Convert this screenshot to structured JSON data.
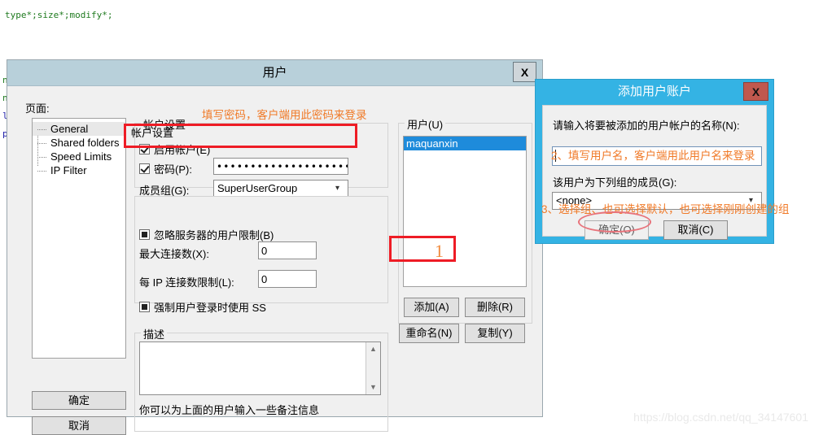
{
  "background": {
    "code_line": "type*;size*;modify*;",
    "left_fragments": [
      "n",
      "n",
      "l",
      "p"
    ]
  },
  "users_window": {
    "title": "用户",
    "close_label": "X",
    "pages_label": "页面:",
    "pages": [
      {
        "label": "General",
        "selected": true
      },
      {
        "label": "Shared folders",
        "selected": false
      },
      {
        "label": "Speed Limits",
        "selected": false
      },
      {
        "label": "IP Filter",
        "selected": false
      }
    ],
    "account_group": {
      "title": "帐户设置",
      "enable_account": {
        "label": "启用帐户(E)",
        "checked": true
      },
      "password": {
        "label": "密码(P):",
        "checked": true,
        "value": "••••••••••••••••••••••••"
      },
      "group_label": "成员组(G):",
      "group_value": "SuperUserGroup"
    },
    "limits_group": {
      "bypass": {
        "label": "忽略服务器的用户限制(B)",
        "state": "indeterminate"
      },
      "max_conn_label": "最大连接数(X):",
      "max_conn_value": "0",
      "per_ip_label": "每 IP 连接数限制(L):",
      "per_ip_value": "0",
      "force_ssl": {
        "label": "强制用户登录时使用 SS",
        "state": "indeterminate"
      }
    },
    "description_group": {
      "title": "描述",
      "value": "",
      "hint": "你可以为上面的用户输入一些备注信息"
    },
    "users_group": {
      "title": "用户(U)",
      "items": [
        {
          "label": "maquanxin",
          "selected": true
        }
      ],
      "buttons": {
        "add": "添加(A)",
        "remove": "删除(R)",
        "rename": "重命名(N)",
        "copy": "复制(Y)"
      }
    },
    "footer_buttons": {
      "ok": "确定",
      "cancel": "取消"
    }
  },
  "add_account_window": {
    "title": "添加用户账户",
    "close_label": "X",
    "name_prompt": "请输入将要被添加的用户帐户的名称(N):",
    "name_value": "",
    "group_prompt": "该用户为下列组的成员(G):",
    "group_value": "<none>",
    "ok_label": "确定(O)",
    "cancel_label": "取消(C)"
  },
  "annotations": {
    "password_note": "填写密码，客户端用此密码来登录",
    "add_button_number": "1",
    "username_note": "2、填写用户名，客户端用此用户名来登录",
    "group_note": "3、选择组、也可选择默认，也可选择刚刚创建的组"
  },
  "watermark": "https://blog.csdn.net/qq_34147601",
  "colors": {
    "title_bar": "#b8d0da",
    "add_title_bar": "#34b3e4",
    "annotation": "#f07a28",
    "highlight": "#ee1c25",
    "selection": "#1e8bdb"
  }
}
